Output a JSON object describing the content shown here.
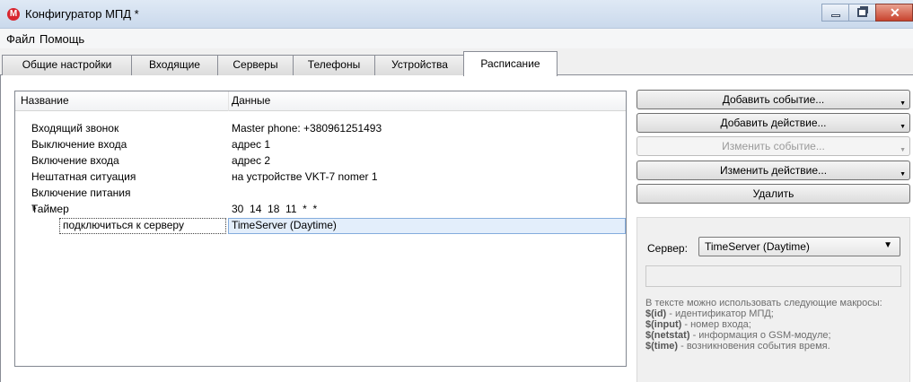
{
  "window": {
    "title": "Конфигуратор МПД *",
    "icon_letter": "M",
    "icon": "app-logo-icon"
  },
  "menu": [
    {
      "label": "Файл"
    },
    {
      "label": "Помощь"
    }
  ],
  "tabs": [
    {
      "label": "Общие настройки",
      "active": false
    },
    {
      "label": "Входящие",
      "active": false
    },
    {
      "label": "Серверы",
      "active": false
    },
    {
      "label": "Телефоны",
      "active": false
    },
    {
      "label": "Устройства",
      "active": false
    },
    {
      "label": "Расписание",
      "active": true
    }
  ],
  "tree": {
    "columns": {
      "name": "Название",
      "data": "Данные"
    },
    "rows": [
      {
        "name": "Входящий звонок",
        "data": "Master phone: +380961251493"
      },
      {
        "name": "Выключение входа",
        "data": "адрес 1"
      },
      {
        "name": "Включение входа",
        "data": "адрес 2"
      },
      {
        "name": "Нештатная ситуация",
        "data": "на устройстве VKT-7 nomer 1"
      },
      {
        "name": "Включение питания",
        "data": ""
      },
      {
        "name": "Таймер",
        "data": "30  14  18  11  *  *",
        "expanded": true
      },
      {
        "name": "подключиться к серверу",
        "data": "TimeServer (Daytime)",
        "child": true,
        "selected": true
      }
    ]
  },
  "actions": {
    "add_event": "Добавить событие...",
    "add_action": "Добавить действие...",
    "edit_event": "Изменить событие...",
    "edit_action": "Изменить действие...",
    "delete": "Удалить"
  },
  "server_panel": {
    "label": "Сервер:",
    "selected": "TimeServer (Daytime)",
    "input_value": "",
    "help_intro": "В тексте можно использовать следующие макросы:",
    "macros": [
      {
        "macro": "$(id)",
        "desc": " - идентификатор МПД;"
      },
      {
        "macro": "$(input)",
        "desc": " - номер входа;"
      },
      {
        "macro": "$(netstat)",
        "desc": " - информация о GSM-модуле;"
      },
      {
        "macro": "$(time)",
        "desc": " - возникновения события время."
      }
    ]
  }
}
